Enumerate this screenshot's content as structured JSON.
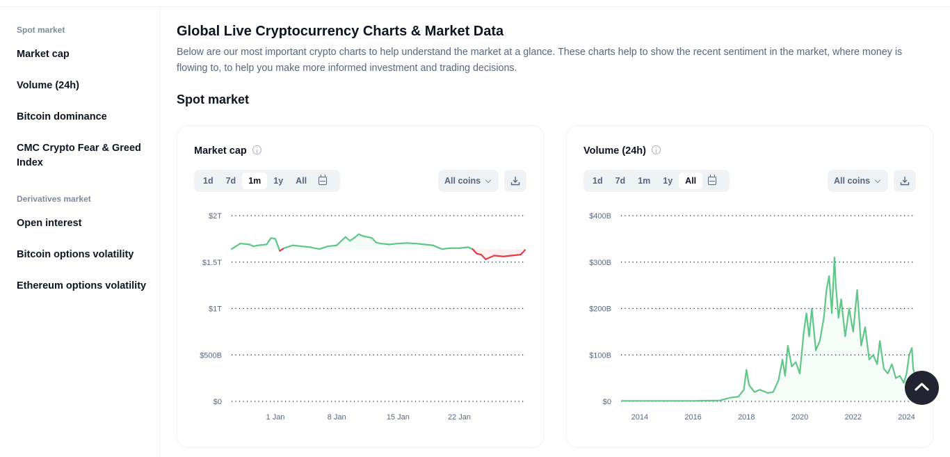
{
  "sidebar": {
    "sections": [
      {
        "title": "Spot market",
        "items": [
          "Market cap",
          "Volume (24h)",
          "Bitcoin dominance",
          "CMC Crypto Fear & Greed Index"
        ]
      },
      {
        "title": "Derivatives market",
        "items": [
          "Open interest",
          "Bitcoin options volatility",
          "Ethereum options volatility"
        ]
      }
    ]
  },
  "page": {
    "title": "Global Live Cryptocurrency Charts & Market Data",
    "description": "Below are our most important crypto charts to help understand the market at a glance. These charts help to show the recent sentiment in the market, where money is flowing to, to help you make more informed investment and trading decisions.",
    "section_title": "Spot market"
  },
  "cards": [
    {
      "title": "Market cap",
      "tabs": [
        "1d",
        "7d",
        "1m",
        "1y",
        "All"
      ],
      "active_tab": "1m",
      "coins_label": "All coins"
    },
    {
      "title": "Volume (24h)",
      "tabs": [
        "1d",
        "7d",
        "1m",
        "1y",
        "All"
      ],
      "active_tab": "All",
      "coins_label": "All coins"
    }
  ],
  "colors": {
    "up": "#5ec788",
    "down": "#ea3943",
    "grid": "#0d1421",
    "axis_text": "#58667e"
  },
  "chart_data": [
    {
      "type": "line",
      "title": "Market cap",
      "xlabel": "",
      "ylabel": "",
      "ylim": [
        0,
        2000000000000
      ],
      "yticks": [
        {
          "value": 2000000000000,
          "label": "$2T"
        },
        {
          "value": 1500000000000,
          "label": "$1.5T"
        },
        {
          "value": 1000000000000,
          "label": "$1T"
        },
        {
          "value": 500000000000,
          "label": "$500B"
        },
        {
          "value": 0,
          "label": "$0"
        }
      ],
      "xlim": [
        -5,
        28.5
      ],
      "xticks": [
        {
          "value": 0,
          "label": "1 Jan"
        },
        {
          "value": 7,
          "label": "8 Jan"
        },
        {
          "value": 14,
          "label": "15 Jan"
        },
        {
          "value": 21,
          "label": "22 Jan"
        }
      ],
      "baseline": 1640000000000,
      "x_unit": "days from 1 Jan",
      "x": [
        -5,
        -4,
        -3,
        -2.5,
        -2,
        -1,
        -0.5,
        0,
        0.5,
        1,
        2,
        3,
        4,
        5,
        6,
        7,
        8,
        8.5,
        9,
        9.5,
        10,
        11,
        11.5,
        12,
        13,
        14,
        15,
        16,
        17,
        18,
        19,
        20,
        21,
        22,
        22.5,
        23,
        23.5,
        24,
        25,
        26,
        27,
        28,
        28.5
      ],
      "values": [
        1640,
        1700,
        1690,
        1670,
        1680,
        1690,
        1760,
        1750,
        1620,
        1650,
        1680,
        1670,
        1660,
        1640,
        1670,
        1680,
        1770,
        1730,
        1760,
        1800,
        1780,
        1760,
        1710,
        1700,
        1690,
        1700,
        1705,
        1700,
        1690,
        1680,
        1640,
        1650,
        1650,
        1660,
        1640,
        1590,
        1580,
        1530,
        1570,
        1560,
        1570,
        1580,
        1630
      ],
      "values_unit": "billions USD",
      "grid": true,
      "legend": "none"
    },
    {
      "type": "area",
      "title": "Volume (24h)",
      "xlabel": "",
      "ylabel": "",
      "ylim": [
        0,
        400000000000
      ],
      "yticks": [
        {
          "value": 400000000000,
          "label": "$400B"
        },
        {
          "value": 300000000000,
          "label": "$300B"
        },
        {
          "value": 200000000000,
          "label": "$200B"
        },
        {
          "value": 100000000000,
          "label": "$100B"
        },
        {
          "value": 0,
          "label": "$0"
        }
      ],
      "xlim": [
        2013.3,
        2024.3
      ],
      "xticks": [
        {
          "value": 2014,
          "label": "2014"
        },
        {
          "value": 2016,
          "label": "2016"
        },
        {
          "value": 2018,
          "label": "2018"
        },
        {
          "value": 2020,
          "label": "2020"
        },
        {
          "value": 2022,
          "label": "2022"
        },
        {
          "value": 2024,
          "label": "2024"
        }
      ],
      "x": [
        2013.3,
        2014,
        2015,
        2016,
        2017,
        2017.4,
        2017.7,
        2017.9,
        2018.0,
        2018.1,
        2018.3,
        2018.5,
        2018.8,
        2019.0,
        2019.2,
        2019.35,
        2019.45,
        2019.55,
        2019.7,
        2019.85,
        2020.0,
        2020.15,
        2020.25,
        2020.35,
        2020.45,
        2020.6,
        2020.75,
        2020.9,
        2021.0,
        2021.1,
        2021.2,
        2021.3,
        2021.35,
        2021.45,
        2021.55,
        2021.7,
        2021.85,
        2022.0,
        2022.15,
        2022.3,
        2022.45,
        2022.6,
        2022.75,
        2022.9,
        2023.0,
        2023.15,
        2023.3,
        2023.45,
        2023.6,
        2023.75,
        2023.9,
        2024.0,
        2024.1,
        2024.2,
        2024.25,
        2024.3
      ],
      "values": [
        1,
        1,
        1,
        1,
        2,
        8,
        10,
        25,
        68,
        35,
        20,
        25,
        18,
        20,
        45,
        90,
        55,
        120,
        75,
        85,
        60,
        150,
        190,
        140,
        200,
        110,
        130,
        180,
        240,
        270,
        190,
        310,
        250,
        180,
        220,
        140,
        200,
        150,
        240,
        120,
        160,
        90,
        100,
        80,
        130,
        70,
        60,
        80,
        50,
        55,
        40,
        60,
        100,
        115,
        70,
        60
      ],
      "values_unit": "billions USD",
      "grid": true,
      "legend": "none"
    }
  ]
}
